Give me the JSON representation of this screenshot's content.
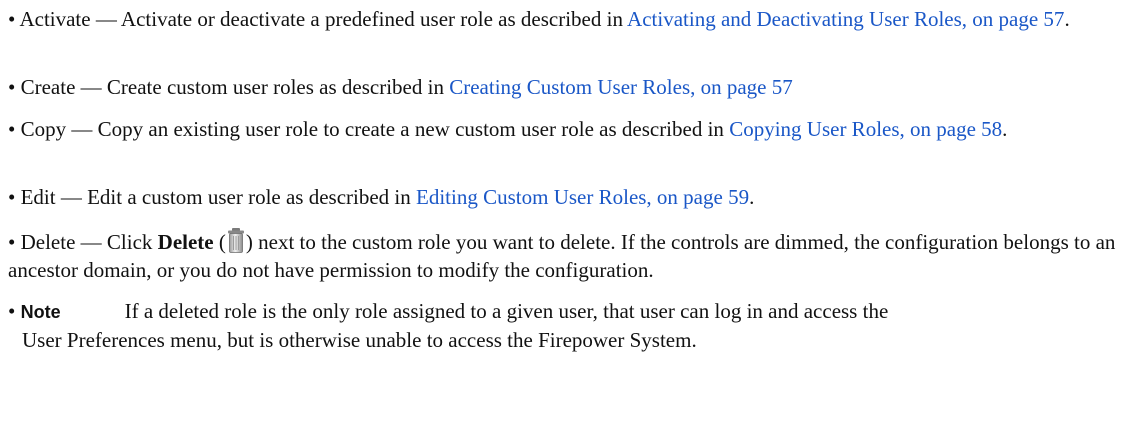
{
  "bullet": "•",
  "items": [
    {
      "name": "Activate",
      "dash_text": " — Activate or deactivate a predefined user role as described in ",
      "link": "Activating and Deactivating User Roles, on page 57",
      "tail": "."
    },
    {
      "name": "Create",
      "dash_text": " — Create custom user roles as described in ",
      "link": "Creating Custom User Roles, on page 57",
      "tail": ""
    },
    {
      "name": "Copy",
      "dash_text": " — Copy an existing user role to create a new custom user role as described in ",
      "link": "Copying User Roles, on page 58",
      "tail": "."
    },
    {
      "name": "Edit",
      "dash_text": " — Edit a custom user role as described in ",
      "link": "Editing Custom User Roles, on page 59",
      "tail": "."
    }
  ],
  "delete_item": {
    "name": "Delete",
    "pre": " — Click ",
    "bold": "Delete",
    "paren_open": " (",
    "icon": "trash-icon",
    "paren_close": ")",
    "post": " next to the custom role you want to delete. If the controls are dimmed, the configuration belongs to an ancestor domain, or you do not have permission to modify the configuration."
  },
  "note": {
    "label": "Note",
    "line1": "If a deleted role is the only role assigned to a given user, that user can log in and access the",
    "line2": "User Preferences menu, but is otherwise unable to access the Firepower System."
  },
  "colors": {
    "link": "#1a57c7",
    "text": "#111111"
  }
}
